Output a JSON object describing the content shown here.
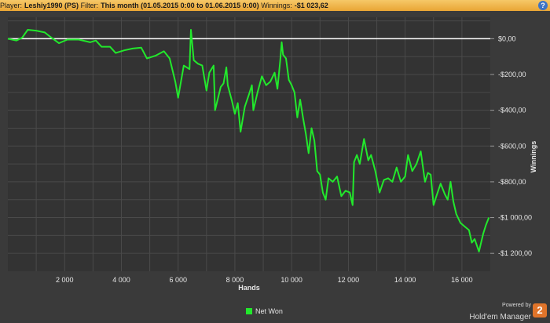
{
  "header": {
    "player_label": "Player:",
    "player_value": "Leshiy1990 (PS)",
    "filter_label": "Filter:",
    "filter_value": "This month (01.05.2015 0:00 to 01.06.2015 0:00)",
    "winnings_label": "Winnings:",
    "winnings_value": "-$1 023,62",
    "help_icon": "question-icon",
    "help_glyph": "?"
  },
  "legend": {
    "label": "Net Won",
    "color": "#22e82c"
  },
  "branding": {
    "powered_by": "Powered by",
    "name": "Hold'em Manager",
    "badge": "2",
    "badge_color": "#e0742a"
  },
  "chart_data": {
    "type": "line",
    "xlabel": "Hands",
    "ylabel": "Winnings",
    "xlim": [
      0,
      17000
    ],
    "ylim": [
      -1300,
      120
    ],
    "x_ticks": [
      2000,
      4000,
      6000,
      8000,
      10000,
      12000,
      14000,
      16000
    ],
    "x_tick_labels": [
      "2 000",
      "4 000",
      "6 000",
      "8 000",
      "10 000",
      "12 000",
      "14 000",
      "16 000"
    ],
    "y_ticks": [
      0,
      -200,
      -400,
      -600,
      -800,
      -1000,
      -1200
    ],
    "y_tick_labels": [
      "$0,00",
      "-$200,00",
      "-$400,00",
      "-$600,00",
      "-$800,00",
      "-$1 000,00",
      "-$1 200,00"
    ],
    "grid": true,
    "zero_line": true,
    "legend_position": "bottom-center",
    "series": [
      {
        "name": "Net Won",
        "color": "#22e82c",
        "points": [
          [
            0,
            0
          ],
          [
            300,
            -10
          ],
          [
            500,
            5
          ],
          [
            700,
            50
          ],
          [
            1000,
            45
          ],
          [
            1300,
            35
          ],
          [
            1500,
            10
          ],
          [
            1800,
            -25
          ],
          [
            2100,
            -5
          ],
          [
            2500,
            -5
          ],
          [
            2900,
            -20
          ],
          [
            3100,
            -10
          ],
          [
            3300,
            -45
          ],
          [
            3600,
            -45
          ],
          [
            3800,
            -80
          ],
          [
            4100,
            -65
          ],
          [
            4400,
            -55
          ],
          [
            4700,
            -50
          ],
          [
            4900,
            -110
          ],
          [
            5200,
            -95
          ],
          [
            5500,
            -70
          ],
          [
            5700,
            -110
          ],
          [
            5900,
            -240
          ],
          [
            6000,
            -330
          ],
          [
            6200,
            -150
          ],
          [
            6400,
            -170
          ],
          [
            6450,
            50
          ],
          [
            6550,
            -120
          ],
          [
            6700,
            -140
          ],
          [
            6850,
            -150
          ],
          [
            7000,
            -290
          ],
          [
            7100,
            -190
          ],
          [
            7250,
            -150
          ],
          [
            7300,
            -400
          ],
          [
            7500,
            -270
          ],
          [
            7600,
            -250
          ],
          [
            7700,
            -160
          ],
          [
            7750,
            -260
          ],
          [
            7900,
            -350
          ],
          [
            8000,
            -420
          ],
          [
            8100,
            -360
          ],
          [
            8200,
            -520
          ],
          [
            8350,
            -380
          ],
          [
            8500,
            -310
          ],
          [
            8600,
            -260
          ],
          [
            8650,
            -400
          ],
          [
            8800,
            -300
          ],
          [
            8950,
            -210
          ],
          [
            9100,
            -260
          ],
          [
            9250,
            -240
          ],
          [
            9400,
            -190
          ],
          [
            9500,
            -280
          ],
          [
            9600,
            -120
          ],
          [
            9650,
            -20
          ],
          [
            9700,
            -90
          ],
          [
            9800,
            -110
          ],
          [
            9900,
            -230
          ],
          [
            10000,
            -260
          ],
          [
            10100,
            -300
          ],
          [
            10200,
            -440
          ],
          [
            10300,
            -340
          ],
          [
            10400,
            -440
          ],
          [
            10500,
            -530
          ],
          [
            10600,
            -640
          ],
          [
            10700,
            -500
          ],
          [
            10800,
            -570
          ],
          [
            10900,
            -740
          ],
          [
            11000,
            -760
          ],
          [
            11100,
            -860
          ],
          [
            11200,
            -900
          ],
          [
            11300,
            -780
          ],
          [
            11450,
            -800
          ],
          [
            11600,
            -770
          ],
          [
            11750,
            -880
          ],
          [
            11900,
            -850
          ],
          [
            12050,
            -860
          ],
          [
            12150,
            -930
          ],
          [
            12200,
            -690
          ],
          [
            12300,
            -650
          ],
          [
            12400,
            -700
          ],
          [
            12550,
            -560
          ],
          [
            12700,
            -680
          ],
          [
            12800,
            -650
          ],
          [
            12950,
            -740
          ],
          [
            13100,
            -860
          ],
          [
            13250,
            -790
          ],
          [
            13400,
            -780
          ],
          [
            13550,
            -800
          ],
          [
            13700,
            -720
          ],
          [
            13850,
            -800
          ],
          [
            14000,
            -770
          ],
          [
            14100,
            -650
          ],
          [
            14250,
            -740
          ],
          [
            14400,
            -700
          ],
          [
            14550,
            -630
          ],
          [
            14700,
            -800
          ],
          [
            14800,
            -750
          ],
          [
            14900,
            -760
          ],
          [
            15000,
            -930
          ],
          [
            15100,
            -880
          ],
          [
            15250,
            -810
          ],
          [
            15400,
            -870
          ],
          [
            15500,
            -900
          ],
          [
            15600,
            -800
          ],
          [
            15700,
            -910
          ],
          [
            15800,
            -980
          ],
          [
            15950,
            -1030
          ],
          [
            16100,
            -1050
          ],
          [
            16250,
            -1070
          ],
          [
            16350,
            -1140
          ],
          [
            16450,
            -1120
          ],
          [
            16600,
            -1190
          ],
          [
            16750,
            -1090
          ],
          [
            16850,
            -1040
          ],
          [
            16950,
            -1000
          ]
        ]
      }
    ]
  }
}
